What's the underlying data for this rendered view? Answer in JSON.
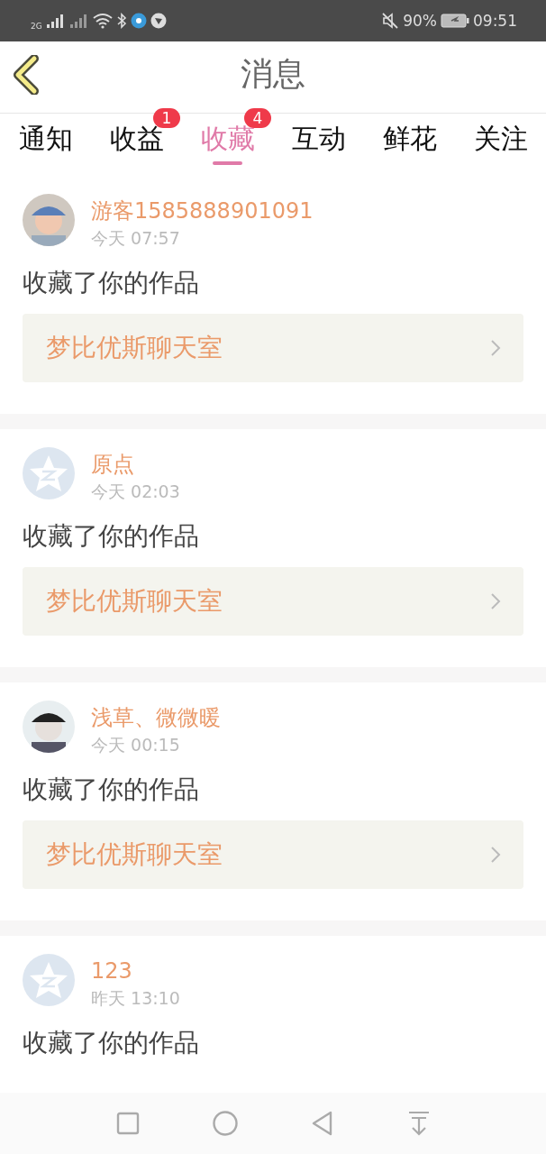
{
  "status_bar": {
    "network": "2G",
    "battery": "90%",
    "time": "09:51"
  },
  "header": {
    "title": "消息"
  },
  "tabs": [
    {
      "label": "通知",
      "selected": false
    },
    {
      "label": "收益",
      "selected": false,
      "badge": "1"
    },
    {
      "label": "收藏",
      "selected": true,
      "badge": "4"
    },
    {
      "label": "互动",
      "selected": false
    },
    {
      "label": "鲜花",
      "selected": false
    },
    {
      "label": "关注",
      "selected": false
    }
  ],
  "messages": [
    {
      "name": "游客1585888901091",
      "time": "今天 07:57",
      "text": "收藏了你的作品",
      "link": "梦比优斯聊天室"
    },
    {
      "kind": "default",
      "name": "原点",
      "time": "今天 02:03",
      "text": "收藏了你的作品",
      "link": "梦比优斯聊天室"
    },
    {
      "name": "浅草、微微暖",
      "time": "今天 00:15",
      "text": "收藏了你的作品",
      "link": "梦比优斯聊天室"
    },
    {
      "kind": "default",
      "name": "123",
      "time": "昨天 13:10",
      "text": "收藏了你的作品"
    }
  ]
}
